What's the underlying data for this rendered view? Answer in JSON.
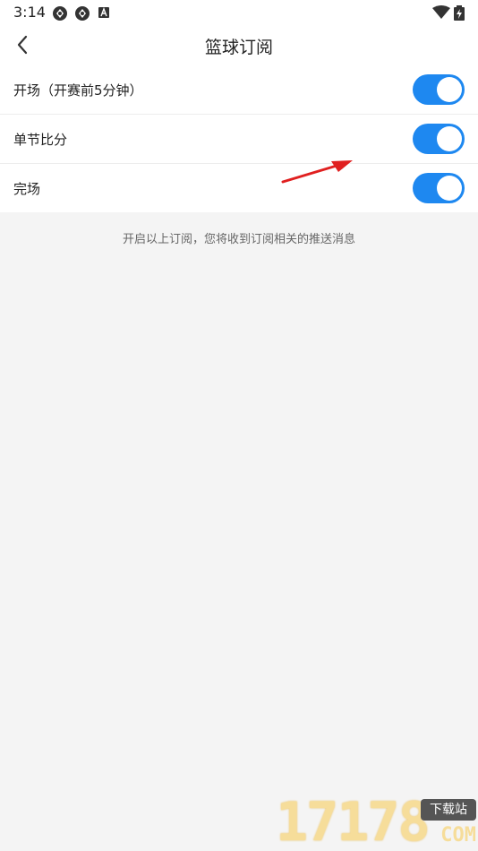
{
  "status_bar": {
    "time": "3:14",
    "icons": [
      "app-notification-icon",
      "app-notification-icon",
      "a-icon",
      "wifi-icon",
      "battery-icon"
    ]
  },
  "header": {
    "title": "篮球订阅",
    "back_icon": "back-arrow-icon"
  },
  "settings": {
    "items": [
      {
        "label": "开场（开赛前5分钟）",
        "enabled": true
      },
      {
        "label": "单节比分",
        "enabled": true
      },
      {
        "label": "完场",
        "enabled": true
      }
    ],
    "hint": "开启以上订阅，您将收到订阅相关的推送消息"
  },
  "colors": {
    "toggle_on": "#1e88f0",
    "background": "#f4f4f4",
    "annotation": "#e02020"
  },
  "watermark": {
    "digits": "17178",
    "badge": "下载站",
    "suffix": "COM"
  }
}
